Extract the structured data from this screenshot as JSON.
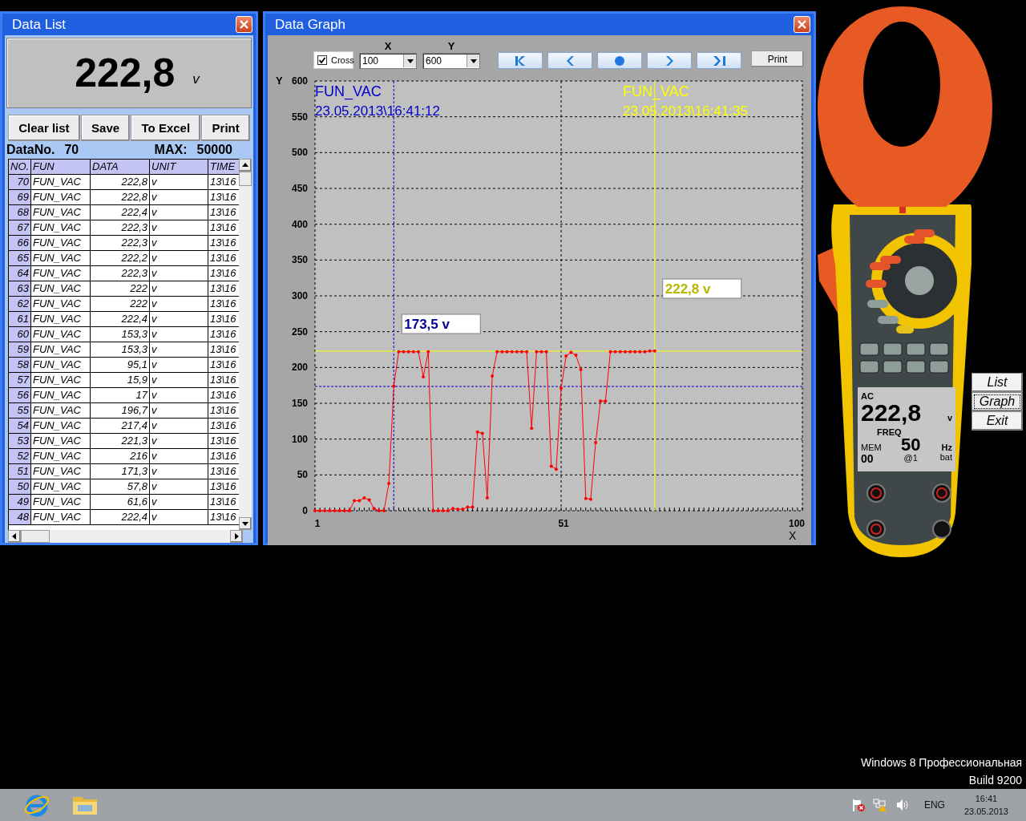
{
  "data_list": {
    "title": "Data List",
    "reading": {
      "value": "222,8",
      "unit": "v"
    },
    "buttons": [
      "Clear list",
      "Save",
      "To Excel",
      "Print"
    ],
    "data_no": {
      "label": "DataNo.",
      "value": "70"
    },
    "max": {
      "label": "MAX:",
      "value": "50000"
    },
    "table": {
      "columns": [
        "NO.",
        "FUN",
        "DATA",
        "UNIT",
        "TIME"
      ],
      "rows": [
        [
          "70",
          "FUN_VAC",
          "222,8",
          "v",
          "13\\16"
        ],
        [
          "69",
          "FUN_VAC",
          "222,8",
          "v",
          "13\\16"
        ],
        [
          "68",
          "FUN_VAC",
          "222,4",
          "v",
          "13\\16"
        ],
        [
          "67",
          "FUN_VAC",
          "222,3",
          "v",
          "13\\16"
        ],
        [
          "66",
          "FUN_VAC",
          "222,3",
          "v",
          "13\\16"
        ],
        [
          "65",
          "FUN_VAC",
          "222,2",
          "v",
          "13\\16"
        ],
        [
          "64",
          "FUN_VAC",
          "222,3",
          "v",
          "13\\16"
        ],
        [
          "63",
          "FUN_VAC",
          "222",
          "v",
          "13\\16"
        ],
        [
          "62",
          "FUN_VAC",
          "222",
          "v",
          "13\\16"
        ],
        [
          "61",
          "FUN_VAC",
          "222,4",
          "v",
          "13\\16"
        ],
        [
          "60",
          "FUN_VAC",
          "153,3",
          "v",
          "13\\16"
        ],
        [
          "59",
          "FUN_VAC",
          "153,3",
          "v",
          "13\\16"
        ],
        [
          "58",
          "FUN_VAC",
          "95,1",
          "v",
          "13\\16"
        ],
        [
          "57",
          "FUN_VAC",
          "15,9",
          "v",
          "13\\16"
        ],
        [
          "56",
          "FUN_VAC",
          "17",
          "v",
          "13\\16"
        ],
        [
          "55",
          "FUN_VAC",
          "196,7",
          "v",
          "13\\16"
        ],
        [
          "54",
          "FUN_VAC",
          "217,4",
          "v",
          "13\\16"
        ],
        [
          "53",
          "FUN_VAC",
          "221,3",
          "v",
          "13\\16"
        ],
        [
          "52",
          "FUN_VAC",
          "216",
          "v",
          "13\\16"
        ],
        [
          "51",
          "FUN_VAC",
          "171,3",
          "v",
          "13\\16"
        ],
        [
          "50",
          "FUN_VAC",
          "57,8",
          "v",
          "13\\16"
        ],
        [
          "49",
          "FUN_VAC",
          "61,6",
          "v",
          "13\\16"
        ],
        [
          "48",
          "FUN_VAC",
          "222,4",
          "v",
          "13\\16"
        ]
      ]
    }
  },
  "data_graph": {
    "title": "Data Graph",
    "cross": {
      "label": "Cross",
      "checked": true
    },
    "axis_selectors": [
      {
        "label": "X",
        "value": "100"
      },
      {
        "label": "Y",
        "value": "600"
      }
    ],
    "print_button": "Print",
    "cursors": [
      {
        "title": "FUN_VAC",
        "time": "23.05.2013\\16:41:12",
        "color": "#0000c8"
      },
      {
        "title": "FUN_VAC",
        "time": "23.05.2013\\16:41:35",
        "color": "#ffff00"
      }
    ],
    "chart_data": {
      "type": "line",
      "xlabel": "X",
      "ylabel": "Y",
      "xlim": [
        1,
        100
      ],
      "ylim": [
        0,
        600
      ],
      "xticks": [
        1,
        51,
        100
      ],
      "yticks": [
        0,
        50,
        100,
        150,
        200,
        250,
        300,
        350,
        400,
        450,
        500,
        550,
        600
      ],
      "grid": true,
      "x": [
        1,
        2,
        3,
        4,
        5,
        6,
        7,
        8,
        9,
        10,
        11,
        12,
        13,
        14,
        15,
        16,
        17,
        18,
        19,
        20,
        21,
        22,
        23,
        24,
        25,
        26,
        27,
        28,
        29,
        30,
        31,
        32,
        33,
        34,
        35,
        36,
        37,
        38,
        39,
        40,
        41,
        42,
        43,
        44,
        45,
        46,
        47,
        48,
        49,
        50,
        51,
        52,
        53,
        54,
        55,
        56,
        57,
        58,
        59,
        60,
        61,
        62,
        63,
        64,
        65,
        66,
        67,
        68,
        69,
        70
      ],
      "series": [
        {
          "color": "#ff0000",
          "values": [
            0,
            0,
            0,
            0,
            0,
            0,
            0,
            0,
            14,
            14,
            18,
            15,
            3,
            0,
            0,
            38,
            174,
            222,
            222,
            222,
            222,
            222,
            187,
            222,
            0,
            0,
            0,
            0,
            3,
            2,
            2,
            5,
            5,
            110,
            108,
            18,
            188,
            222,
            222,
            222,
            222,
            222,
            222,
            222,
            115,
            222,
            222,
            222,
            62,
            58,
            171,
            216,
            221,
            217,
            197,
            17,
            16,
            95,
            153,
            153,
            222,
            222,
            222,
            222,
            222,
            222,
            222,
            222,
            223,
            223
          ]
        }
      ],
      "ref_lines": [
        {
          "axis": "x",
          "value": 17,
          "color": "#0000c8"
        },
        {
          "axis": "y",
          "value": 173.5,
          "color": "#0000c8"
        },
        {
          "axis": "x",
          "value": 70,
          "color": "#ffff00"
        },
        {
          "axis": "y",
          "value": 222.8,
          "color": "#ffff00"
        }
      ],
      "annotations": [
        "173,5 v",
        "222,8 v"
      ]
    }
  },
  "meter_display": {
    "mode": "AC",
    "value": "222,8",
    "unit": "v",
    "freq_label": "FREQ",
    "freq": "50",
    "freq_unit": "Hz",
    "mem_label": "MEM",
    "mem": "00",
    "range": "@1",
    "battery": "bat"
  },
  "side_buttons": [
    {
      "label": "List",
      "focused": false
    },
    {
      "label": "Graph",
      "focused": true
    },
    {
      "label": "Exit",
      "focused": false
    }
  ],
  "os_version": {
    "edition": "Windows 8 Профессиональная",
    "build": "Build 9200"
  },
  "taskbar": {
    "language": "ENG",
    "time": "16:41",
    "date": "23.05.2013"
  }
}
